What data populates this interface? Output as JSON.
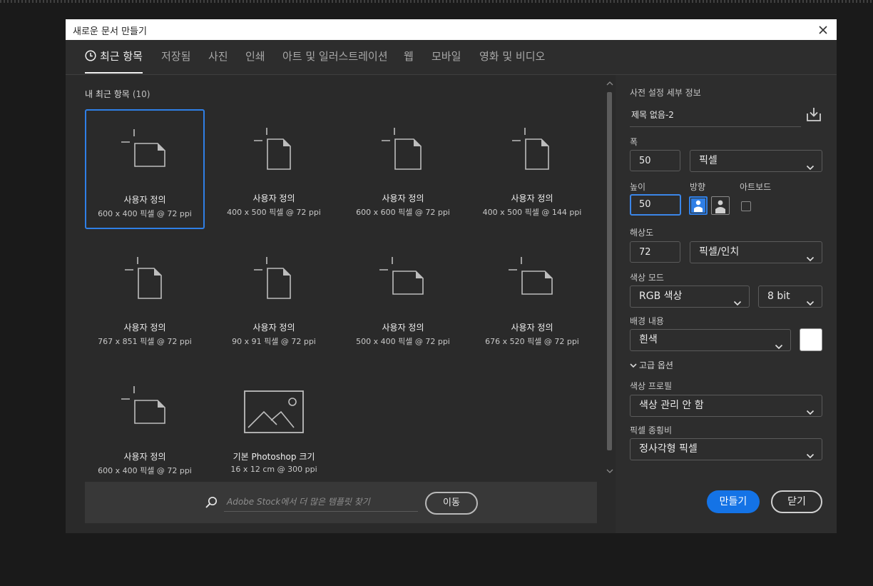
{
  "dialog": {
    "title": "새로운 문서 만들기"
  },
  "tabs": [
    {
      "label": "최근 항목"
    },
    {
      "label": "저장됨"
    },
    {
      "label": "사진"
    },
    {
      "label": "인쇄"
    },
    {
      "label": "아트 및 일러스트레이션"
    },
    {
      "label": "웹"
    },
    {
      "label": "모바일"
    },
    {
      "label": "영화 및 비디오"
    }
  ],
  "recent": {
    "heading": "내 최근 항목",
    "count": "(10)",
    "items": [
      {
        "name": "사용자 정의",
        "dims": "600 x 400 픽셀 @ 72 ppi",
        "icon": "landscape-document-icon"
      },
      {
        "name": "사용자 정의",
        "dims": "400 x 500 픽셀 @ 72 ppi",
        "icon": "portrait-document-icon"
      },
      {
        "name": "사용자 정의",
        "dims": "600 x 600 픽셀 @ 72 ppi",
        "icon": "portrait-document-icon"
      },
      {
        "name": "사용자 정의",
        "dims": "400 x 500 픽셀 @ 144 ppi",
        "icon": "portrait-document-icon"
      },
      {
        "name": "사용자 정의",
        "dims": "767 x 851 픽셀 @ 72 ppi",
        "icon": "portrait-document-icon"
      },
      {
        "name": "사용자 정의",
        "dims": "90 x 91 픽셀 @ 72 ppi",
        "icon": "portrait-document-icon"
      },
      {
        "name": "사용자 정의",
        "dims": "500 x 400 픽셀 @ 72 ppi",
        "icon": "landscape-document-icon"
      },
      {
        "name": "사용자 정의",
        "dims": "676 x 520 픽셀 @ 72 ppi",
        "icon": "landscape-document-icon"
      },
      {
        "name": "사용자 정의",
        "dims": "600 x 400 픽셀 @ 72 ppi",
        "icon": "landscape-document-icon"
      },
      {
        "name": "기본 Photoshop 크기",
        "dims": "16 x 12 cm @ 300 ppi",
        "icon": "image-placeholder-icon"
      }
    ]
  },
  "search": {
    "placeholder": "Adobe Stock에서 더 많은 템플릿 찾기",
    "go_label": "이동"
  },
  "preset": {
    "heading": "사전 설정 세부 정보",
    "name": "제목 없음-2",
    "width_label": "폭",
    "width_value": "50",
    "width_unit": "픽셀",
    "height_label": "높이",
    "height_value": "50",
    "orientation_label": "방향",
    "artboard_label": "아트보드",
    "resolution_label": "해상도",
    "resolution_value": "72",
    "resolution_unit": "픽셀/인치",
    "color_mode_label": "색상 모드",
    "color_mode": "RGB 색상",
    "bit_depth": "8 bit",
    "background_label": "배경 내용",
    "background": "흰색",
    "background_swatch": "#ffffff",
    "advanced_label": "고급 옵션",
    "color_profile_label": "색상 프로필",
    "color_profile": "색상 관리 안 함",
    "pixel_aspect_label": "픽셀 종횡비",
    "pixel_aspect": "정사각형 픽셀"
  },
  "actions": {
    "create_label": "만들기",
    "close_label": "닫기"
  },
  "colors": {
    "accent": "#1473e6",
    "selected_border": "#2f7fe6",
    "dialog_bg": "#2d2d2d"
  }
}
